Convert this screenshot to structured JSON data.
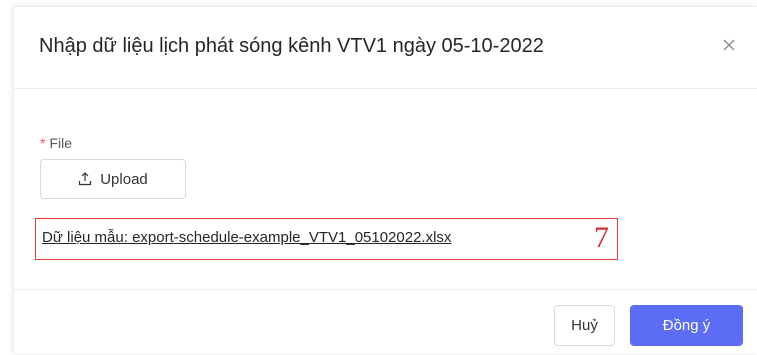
{
  "modal": {
    "title": "Nhập dữ liệu lịch phát sóng kênh VTV1 ngày 05-10-2022"
  },
  "form": {
    "required_mark": "*",
    "file_label": "File",
    "upload_label": "Upload",
    "sample_link_text": "Dữ liệu mẫu: export-schedule-example_VTV1_05102022.xlsx",
    "annotation_number": "7"
  },
  "footer": {
    "cancel_label": "Huỷ",
    "ok_label": "Đồng ý"
  },
  "colors": {
    "primary": "#5b6cf5",
    "required": "#ff4d4f",
    "annotation": "#e53935"
  },
  "icons": {
    "close": "close-icon",
    "upload": "upload-icon"
  }
}
